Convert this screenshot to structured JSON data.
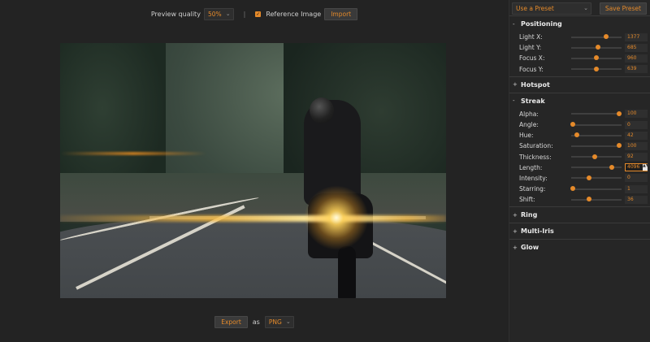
{
  "toolbar": {
    "preview_quality_label": "Preview quality",
    "preview_quality_value": "50%",
    "separator": "|",
    "reference_checked": true,
    "reference_label": "Reference Image",
    "import_label": "Import"
  },
  "export": {
    "export_label": "Export",
    "as_label": "as",
    "format_value": "PNG"
  },
  "panel": {
    "preset_value": "Use a Preset",
    "save_preset_label": "Save Preset",
    "sections": {
      "positioning": {
        "title": "Positioning",
        "toggle": "-",
        "rows": [
          {
            "label": "Light X:",
            "value": "1377",
            "fraction": 0.7
          },
          {
            "label": "Light Y:",
            "value": "685",
            "fraction": 0.53
          },
          {
            "label": "Focus X:",
            "value": "960",
            "fraction": 0.5
          },
          {
            "label": "Focus Y:",
            "value": "639",
            "fraction": 0.5
          }
        ]
      },
      "hotspot": {
        "title": "Hotspot",
        "toggle": "+"
      },
      "streak": {
        "title": "Streak",
        "toggle": "-",
        "rows": [
          {
            "label": "Alpha:",
            "value": "100",
            "fraction": 0.95
          },
          {
            "label": "Angle:",
            "value": "0",
            "fraction": 0.03
          },
          {
            "label": "Hue:",
            "value": "42",
            "fraction": 0.12
          },
          {
            "label": "Saturation:",
            "value": "100",
            "fraction": 0.95
          },
          {
            "label": "Thickness:",
            "value": "92",
            "fraction": 0.47
          },
          {
            "label": "Length:",
            "value": "4096",
            "fraction": 0.8
          },
          {
            "label": "Intensity:",
            "value": "0",
            "fraction": 0.35
          },
          {
            "label": "Starring:",
            "value": "1",
            "fraction": 0.03
          },
          {
            "label": "Shift:",
            "value": "36",
            "fraction": 0.36
          }
        ]
      },
      "ring": {
        "title": "Ring",
        "toggle": "+"
      },
      "multi_iris": {
        "title": "Multi-Iris",
        "toggle": "+"
      },
      "glow": {
        "title": "Glow",
        "toggle": "+"
      }
    }
  }
}
